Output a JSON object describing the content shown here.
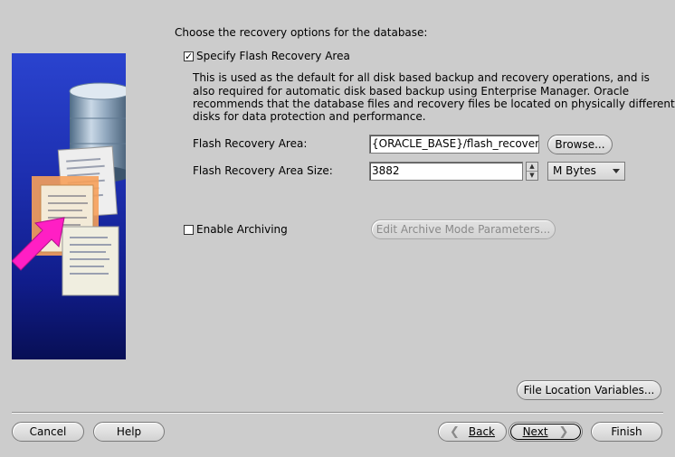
{
  "heading": "Choose the recovery options for the database:",
  "flash": {
    "checkbox_label": "Specify Flash Recovery Area",
    "checked": true,
    "description": [
      "This is used as the default for all disk based backup and recovery operations, and is",
      "also required for automatic disk based backup using Enterprise Manager. Oracle",
      "recommends that the database files and recovery files be located on physically different",
      "disks for data protection and performance."
    ],
    "area_label": "Flash Recovery Area:",
    "area_value": "{ORACLE_BASE}/flash_recovery_",
    "browse_label": "Browse...",
    "size_label": "Flash Recovery Area Size:",
    "size_value": "3882",
    "unit": "M Bytes"
  },
  "archiving": {
    "checkbox_label": "Enable Archiving",
    "checked": false,
    "edit_params_label": "Edit Archive Mode Parameters..."
  },
  "file_location_variables_label": "File Location Variables...",
  "footer": {
    "cancel": "Cancel",
    "help": "Help",
    "back": "Back",
    "next": "Next",
    "finish": "Finish"
  },
  "colors": {
    "background": "#cccccc",
    "illustration_blue": "#1d2fb0",
    "arrow_magenta": "#ff1fc4"
  }
}
